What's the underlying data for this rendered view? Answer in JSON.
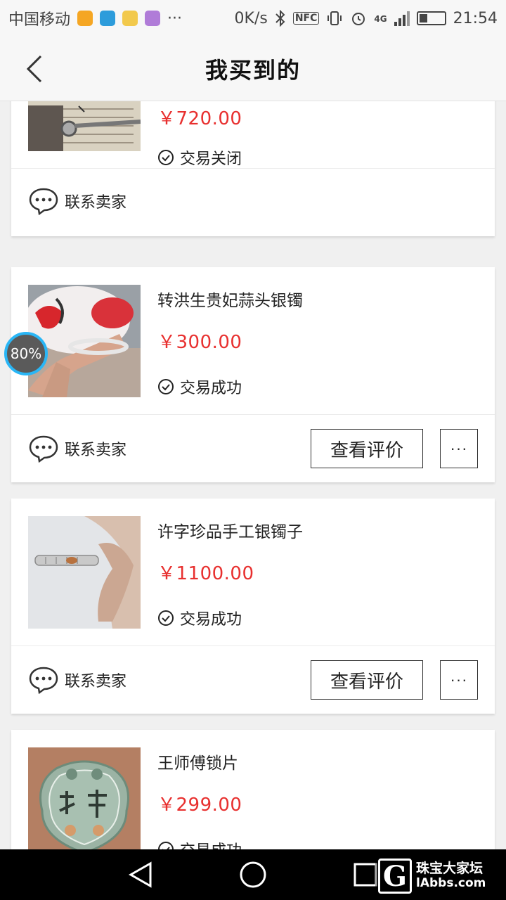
{
  "status_bar": {
    "carrier": "中国移动",
    "more": "···",
    "speed": "0K/s",
    "nfc": "NFC",
    "network": "4G",
    "time": "21:54",
    "battery_level": 0.3
  },
  "header": {
    "title": "我买到的"
  },
  "orders": [
    {
      "name": "",
      "price": "￥720.00",
      "status": "交易关闭",
      "contact_label": "联系卖家"
    },
    {
      "name": "转洪生贵妃蒜头银镯",
      "price": "￥300.00",
      "status": "交易成功",
      "contact_label": "联系卖家",
      "review_label": "查看评价",
      "more_label": "···"
    },
    {
      "name": "许字珍品手工银镯子",
      "price": "￥1100.00",
      "status": "交易成功",
      "contact_label": "联系卖家",
      "review_label": "查看评价",
      "more_label": "···"
    },
    {
      "name": "王师傅锁片",
      "price": "￥299.00",
      "status": "交易成功"
    }
  ],
  "floating_badge": {
    "label": "80%"
  },
  "watermark": {
    "letter": "G",
    "cn": "珠宝大家坛",
    "en": "lAbbs.com"
  },
  "colors": {
    "price": "#e8302f",
    "badge_ring": "#29b6f6"
  }
}
